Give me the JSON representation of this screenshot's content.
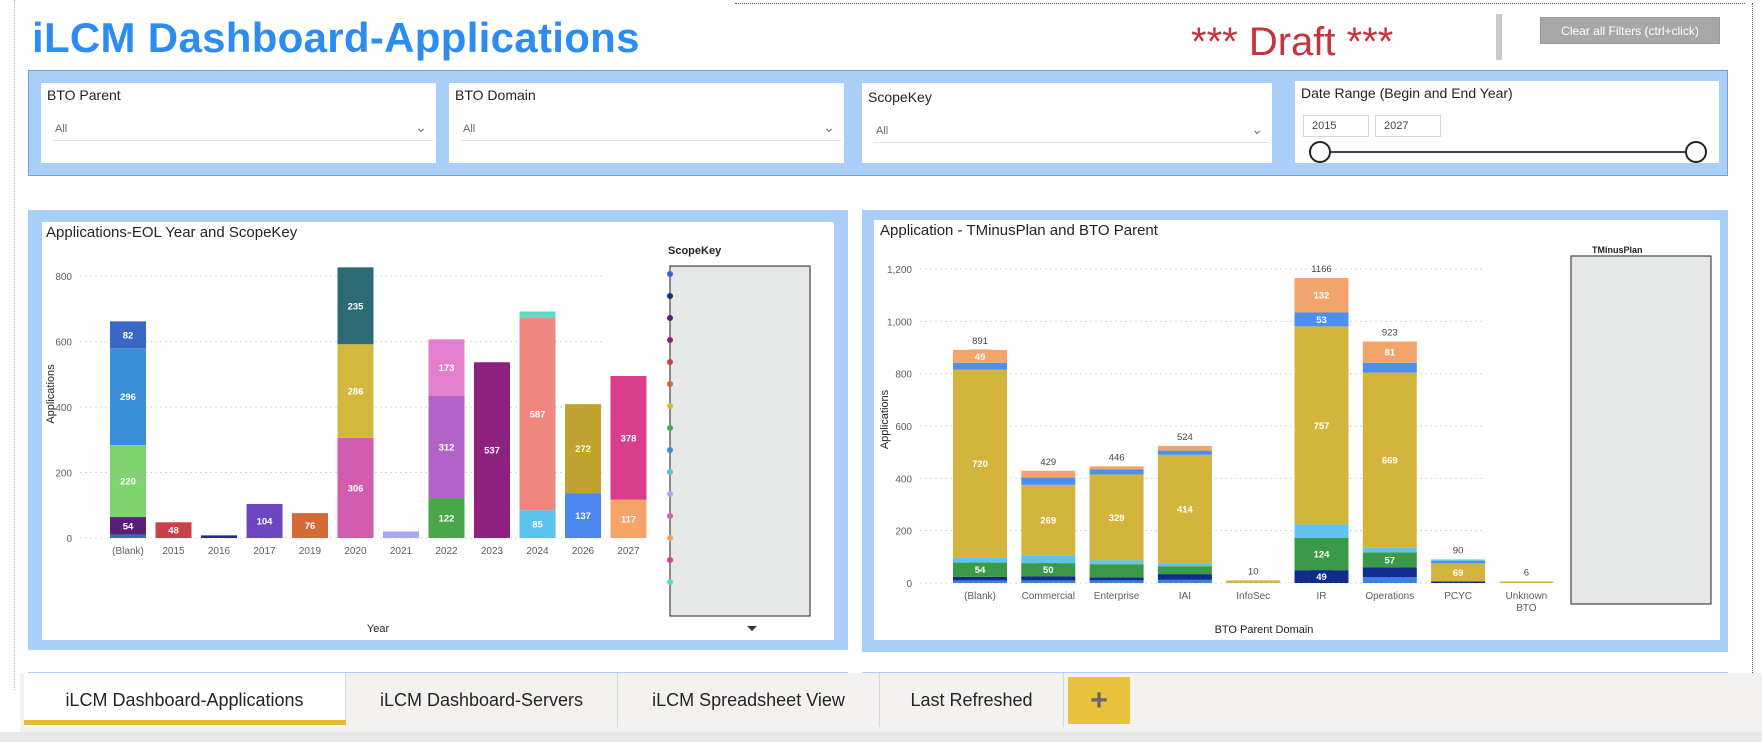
{
  "header": {
    "title": "iLCM Dashboard-Applications",
    "draft": "*** Draft ***",
    "clear_filters": "Clear all Filters (ctrl+click)"
  },
  "filters": {
    "bto_parent": {
      "label": "BTO Parent",
      "value": "All"
    },
    "bto_domain": {
      "label": "BTO Domain",
      "value": "All"
    },
    "scopekey": {
      "label": "ScopeKey",
      "value": "All"
    },
    "date_range": {
      "label": "Date Range (Begin and End Year)",
      "begin": "2015",
      "end": "2027"
    }
  },
  "tabs": [
    {
      "label": "iLCM Dashboard-Applications",
      "active": true
    },
    {
      "label": "iLCM Dashboard-Servers",
      "active": false
    },
    {
      "label": "iLCM Spreadsheet View",
      "active": false
    },
    {
      "label": "Last Refreshed",
      "active": false
    }
  ],
  "chart_data": [
    {
      "type": "bar",
      "stacked": true,
      "title": "Applications-EOL Year and ScopeKey",
      "xlabel": "Year",
      "ylabel": "Applications",
      "legend_title": "ScopeKey",
      "ylim": [
        0,
        880
      ],
      "yticks": [
        0,
        200,
        400,
        600,
        800
      ],
      "categories": [
        "(Blank)",
        "2015",
        "2016",
        "2017",
        "2019",
        "2020",
        "2021",
        "2022",
        "2023",
        "2024",
        "2026",
        "2027"
      ],
      "stacks": [
        [
          {
            "v": 10,
            "c": "#2e6fb5"
          },
          {
            "v": 54,
            "c": "#5a1f7a",
            "label": "54"
          },
          {
            "v": 220,
            "c": "#7ed36e",
            "label": "220"
          },
          {
            "v": 296,
            "c": "#3a8fd6",
            "label": "296"
          },
          {
            "v": 82,
            "c": "#3b67c4",
            "label": "82"
          }
        ],
        [
          {
            "v": 48,
            "c": "#c9424b",
            "label": "48"
          }
        ],
        [
          {
            "v": 8,
            "c": "#1f2a80"
          }
        ],
        [
          {
            "v": 104,
            "c": "#6b47c2",
            "label": "104"
          }
        ],
        [
          {
            "v": 76,
            "c": "#d46a38",
            "label": "76"
          }
        ],
        [
          {
            "v": 306,
            "c": "#d25cad",
            "label": "306"
          },
          {
            "v": 286,
            "c": "#d4b73f",
            "label": "286"
          },
          {
            "v": 235,
            "c": "#2d6b74",
            "label": "235"
          }
        ],
        [
          {
            "v": 20,
            "c": "#a9a7ee"
          }
        ],
        [
          {
            "v": 122,
            "c": "#4aa64b",
            "label": "122"
          },
          {
            "v": 312,
            "c": "#b163c7",
            "label": "312"
          },
          {
            "v": 173,
            "c": "#e47fce",
            "label": "173"
          }
        ],
        [
          {
            "v": 537,
            "c": "#8e217f",
            "label": "537"
          }
        ],
        [
          {
            "v": 85,
            "c": "#59c3eb",
            "label": "85"
          },
          {
            "v": 587,
            "c": "#f0877f",
            "label": "587"
          },
          {
            "v": 20,
            "c": "#5fd8bb"
          }
        ],
        [
          {
            "v": 137,
            "c": "#4b87ee",
            "label": "137"
          },
          {
            "v": 272,
            "c": "#c1a12f",
            "label": "272"
          }
        ],
        [
          {
            "v": 117,
            "c": "#f3a466",
            "label": "117"
          },
          {
            "v": 378,
            "c": "#db3d8d",
            "label": "378"
          }
        ]
      ]
    },
    {
      "type": "bar",
      "stacked": true,
      "title": "Application - TMinusPlan and BTO Parent",
      "xlabel": "BTO Parent Domain",
      "ylabel": "Applications",
      "legend_title": "TMinusPlan",
      "ylim": [
        0,
        1250
      ],
      "yticks": [
        0,
        200,
        400,
        600,
        800,
        1000,
        1200
      ],
      "ytick_labels": [
        "0",
        "200",
        "400",
        "600",
        "800",
        "1,000",
        "1,200"
      ],
      "categories": [
        "(Blank)",
        "Commercial",
        "Enterprise",
        "IAI",
        "InfoSec",
        "IR",
        "Operations",
        "PCYC",
        "Unknown BTO"
      ],
      "totals": [
        "891",
        "429",
        "446",
        "524",
        "10",
        "1166",
        "923",
        "90",
        "6"
      ],
      "stacks": [
        [
          {
            "v": 10,
            "c": "#3b82e0"
          },
          {
            "v": 14,
            "c": "#112b8f"
          },
          {
            "v": 54,
            "c": "#3b9a48",
            "label": "54"
          },
          {
            "v": 18,
            "c": "#5ec3ee"
          },
          {
            "v": 720,
            "c": "#d3b43c",
            "label": "720"
          },
          {
            "v": 26,
            "c": "#4c8ff0"
          },
          {
            "v": 49,
            "c": "#f2a46a",
            "label": "49"
          }
        ],
        [
          {
            "v": 10,
            "c": "#3b82e0"
          },
          {
            "v": 16,
            "c": "#112b8f"
          },
          {
            "v": 50,
            "c": "#3b9a48",
            "label": "50"
          },
          {
            "v": 30,
            "c": "#5ec3ee"
          },
          {
            "v": 269,
            "c": "#d3b43c",
            "label": "269"
          },
          {
            "v": 28,
            "c": "#4c8ff0"
          },
          {
            "v": 26,
            "c": "#f2a46a"
          }
        ],
        [
          {
            "v": 10,
            "c": "#3b82e0"
          },
          {
            "v": 12,
            "c": "#112b8f"
          },
          {
            "v": 50,
            "c": "#3b9a48"
          },
          {
            "v": 14,
            "c": "#5ec3ee"
          },
          {
            "v": 329,
            "c": "#d3b43c",
            "label": "329"
          },
          {
            "v": 19,
            "c": "#4c8ff0"
          },
          {
            "v": 12,
            "c": "#f2a46a"
          }
        ],
        [
          {
            "v": 12,
            "c": "#3b82e0"
          },
          {
            "v": 22,
            "c": "#112b8f"
          },
          {
            "v": 30,
            "c": "#3b9a48"
          },
          {
            "v": 12,
            "c": "#5ec3ee"
          },
          {
            "v": 414,
            "c": "#d3b43c",
            "label": "414"
          },
          {
            "v": 16,
            "c": "#4c8ff0"
          },
          {
            "v": 18,
            "c": "#f2a46a"
          }
        ],
        [
          {
            "v": 10,
            "c": "#d3b43c"
          }
        ],
        [
          {
            "v": 49,
            "c": "#112b8f",
            "label": "49"
          },
          {
            "v": 124,
            "c": "#3b9a48",
            "label": "124"
          },
          {
            "v": 51,
            "c": "#5ec3ee"
          },
          {
            "v": 757,
            "c": "#d3b43c",
            "label": "757"
          },
          {
            "v": 53,
            "c": "#4c8ff0",
            "label": "53"
          },
          {
            "v": 132,
            "c": "#f2a46a",
            "label": "132"
          }
        ],
        [
          {
            "v": 22,
            "c": "#3b82e0"
          },
          {
            "v": 38,
            "c": "#112b8f"
          },
          {
            "v": 57,
            "c": "#3b9a48",
            "label": "57"
          },
          {
            "v": 18,
            "c": "#5ec3ee"
          },
          {
            "v": 669,
            "c": "#d3b43c",
            "label": "669"
          },
          {
            "v": 38,
            "c": "#4c8ff0"
          },
          {
            "v": 81,
            "c": "#f2a46a",
            "label": "81"
          }
        ],
        [
          {
            "v": 6,
            "c": "#112b8f"
          },
          {
            "v": 69,
            "c": "#d3b43c",
            "label": "69"
          },
          {
            "v": 10,
            "c": "#4c8ff0"
          },
          {
            "v": 5,
            "c": "#5ec3ee"
          }
        ],
        [
          {
            "v": 6,
            "c": "#d3b43c"
          }
        ]
      ]
    }
  ]
}
